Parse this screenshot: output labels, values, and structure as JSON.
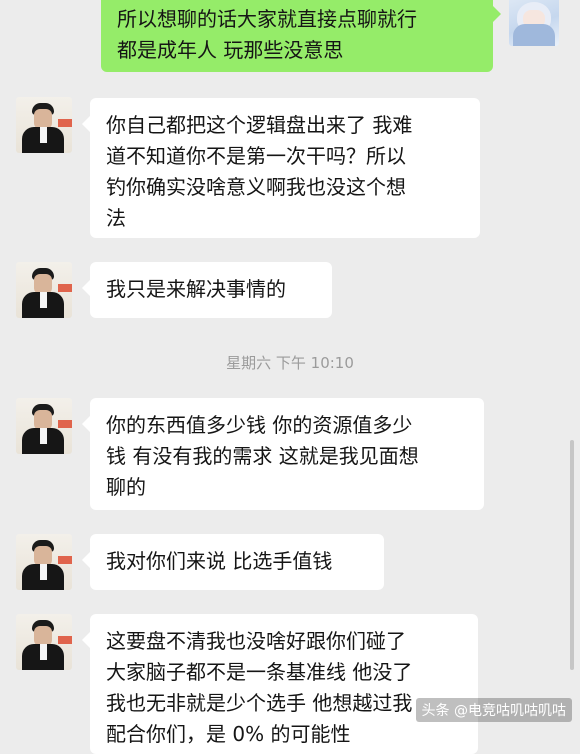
{
  "chat": {
    "messages": [
      {
        "sender": "self",
        "lines": [
          "所以想聊的话大家就直接点聊就行",
          "都是成年人 玩那些没意思"
        ]
      },
      {
        "sender": "other",
        "lines": [
          "你自己都把这个逻辑盘出来了 我难",
          "道不知道你不是第一次干吗？所以",
          "钓你确实没啥意义啊我也没这个想",
          "法"
        ]
      },
      {
        "sender": "other",
        "lines": [
          "我只是来解决事情的"
        ]
      },
      {
        "sender": "other",
        "lines": [
          "你的东西值多少钱 你的资源值多少",
          "钱 有没有我的需求 这就是我见面想",
          "聊的"
        ]
      },
      {
        "sender": "other",
        "lines": [
          "我对你们来说 比选手值钱"
        ]
      },
      {
        "sender": "other",
        "lines": [
          "这要盘不清我也没啥好跟你们碰了",
          "大家脑子都不是一条基准线 他没了",
          "我也无非就是少个选手 他想越过我",
          "配合你们，是 0% 的可能性"
        ]
      }
    ],
    "timestamp": "星期六 下午 10:10"
  },
  "watermark": "头条 @电竞咕叽咕叽咕",
  "colors": {
    "self_bubble": "#95ec69",
    "other_bubble": "#ffffff",
    "background": "#ececec"
  }
}
